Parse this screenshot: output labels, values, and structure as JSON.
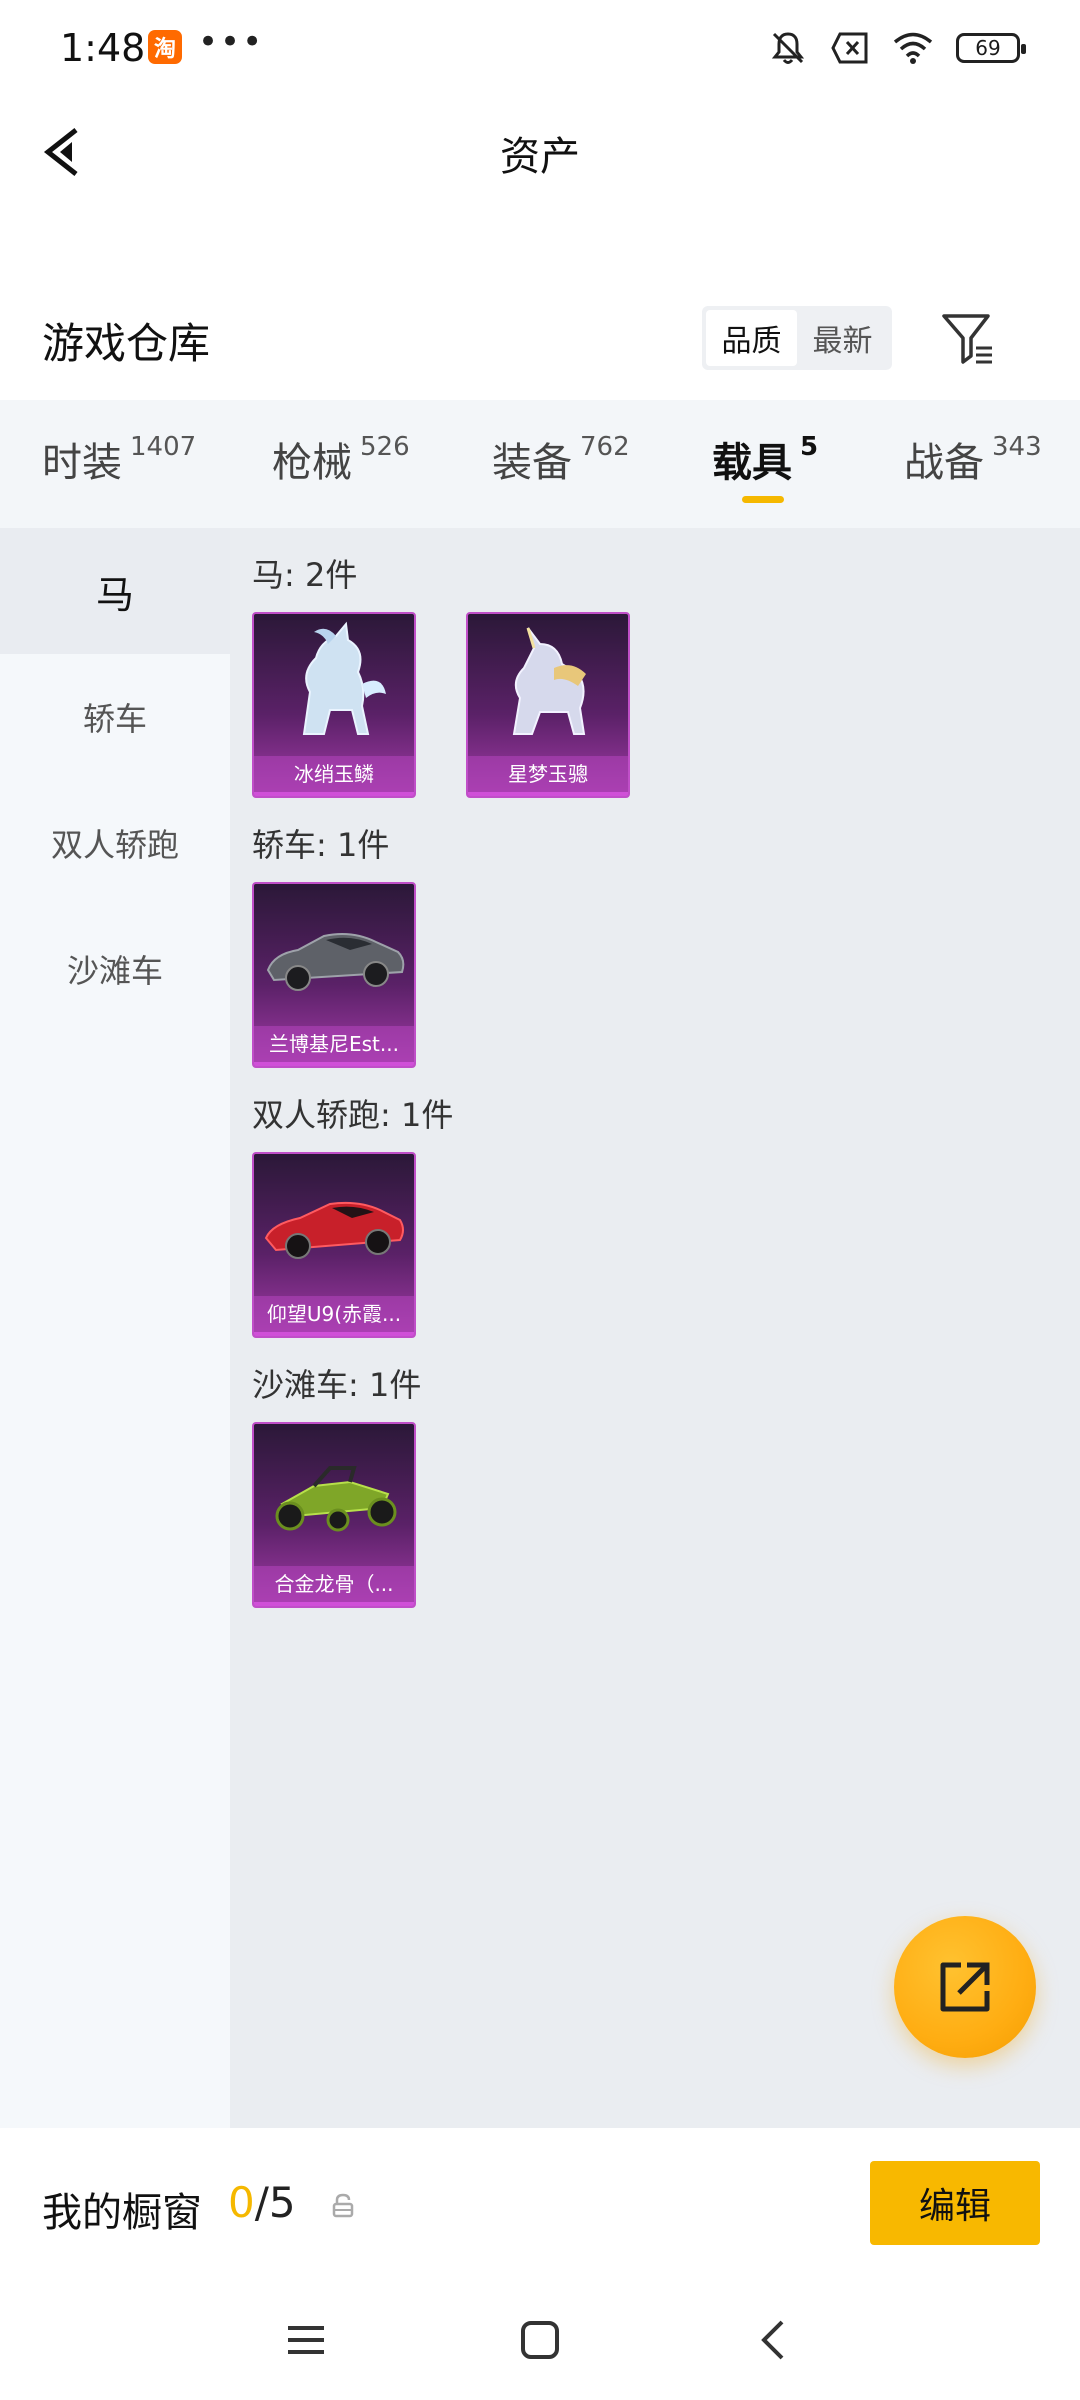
{
  "status_bar": {
    "time": "1:48",
    "app_badge": "淘",
    "dots": "•••",
    "battery": "69"
  },
  "header": {
    "title": "资产"
  },
  "warehouse": {
    "title": "游戏仓库",
    "sort_options": [
      "品质",
      "最新"
    ],
    "active_sort": "品质"
  },
  "tabs": [
    {
      "label": "时装",
      "count": "1407"
    },
    {
      "label": "枪械",
      "count": "526"
    },
    {
      "label": "装备",
      "count": "762"
    },
    {
      "label": "载具",
      "count": "5",
      "active": true
    },
    {
      "label": "战备",
      "count": "343"
    }
  ],
  "sidebar": {
    "items": [
      "马",
      "轿车",
      "双人轿跑",
      "沙滩车"
    ],
    "active": "马"
  },
  "sections": [
    {
      "title": "马: 2件",
      "items": [
        "冰绡玉鳞",
        "星梦玉骢"
      ]
    },
    {
      "title": "轿车: 1件",
      "items": [
        "兰博基尼Est..."
      ]
    },
    {
      "title": "双人轿跑: 1件",
      "items": [
        "仰望U9(赤霞..."
      ]
    },
    {
      "title": "沙滩车: 1件",
      "items": [
        "合金龙骨（..."
      ]
    }
  ],
  "bottom_bar": {
    "title": "我的橱窗",
    "used": "0",
    "total": "/5",
    "edit_label": "编辑"
  },
  "colors": {
    "accent": "#f8b800",
    "card_purple": "#a23aa7",
    "tab_background": "#f3f6f9"
  }
}
